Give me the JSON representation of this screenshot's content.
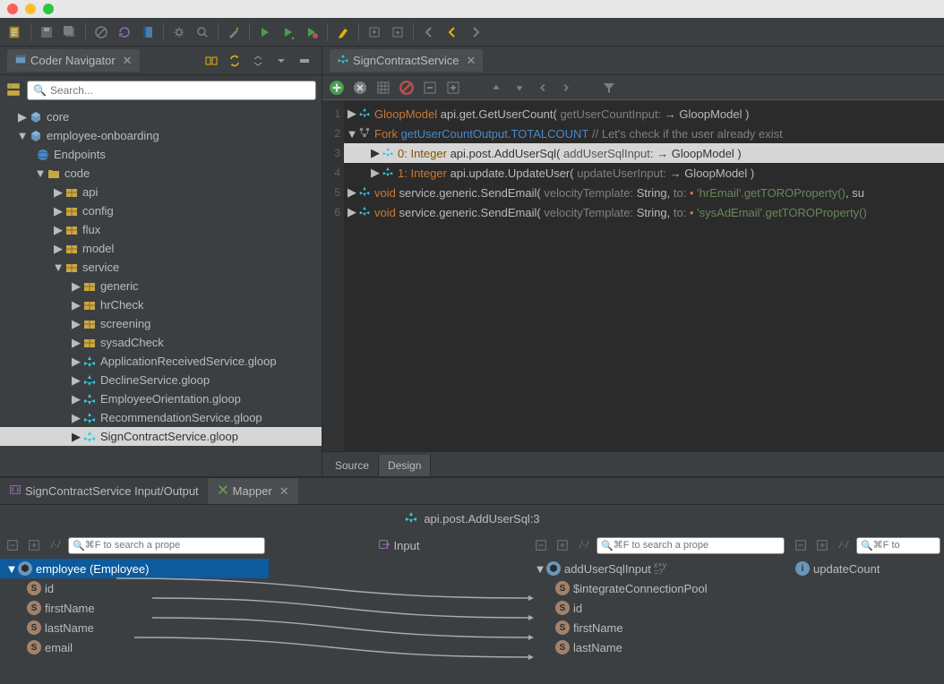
{
  "navigator": {
    "title": "Coder Navigator",
    "search_placeholder": "Search...",
    "tree": {
      "core": "core",
      "proj": "employee-onboarding",
      "endpoints": "Endpoints",
      "code": "code",
      "api": "api",
      "config": "config",
      "flux": "flux",
      "model": "model",
      "service": "service",
      "generic": "generic",
      "hrCheck": "hrCheck",
      "screening": "screening",
      "sysadCheck": "sysadCheck",
      "f1": "ApplicationReceivedService.gloop",
      "f2": "DeclineService.gloop",
      "f3": "EmployeeOrientation.gloop",
      "f4": "RecommendationService.gloop",
      "f5": "SignContractService.gloop"
    }
  },
  "editor": {
    "tab": "SignContractService",
    "lines": {
      "l1a": "GloopModel",
      "l1b": "api.get.GetUserCount(",
      "l1c": "getUserCountInput:",
      "l1d": "→ GloopModel )",
      "l2a": "Fork",
      "l2b": "getUserCountOutput.TOTALCOUNT",
      "l2c": "// Let's check if the user already exist",
      "l3a": "0: Integer",
      "l3b": "api.post.AddUserSql(",
      "l3c": "addUserSqlInput:",
      "l3d": "→ GloopModel )",
      "l4a": "1: Integer",
      "l4b": "api.update.UpdateUser(",
      "l4c": "updateUserInput:",
      "l4d": "→ GloopModel )",
      "l5a": "void",
      "l5b": "service.generic.SendEmail(",
      "l5c": "velocityTemplate:",
      "l5d": "String,",
      "l5e": "to:",
      "l5f": "'hrEmail'.getTOROProperty()",
      "l5g": ", su",
      "l6a": "void",
      "l6b": "service.generic.SendEmail(",
      "l6c": "velocityTemplate:",
      "l6d": "String,",
      "l6e": "to:",
      "l6f": "'sysAdEmail'.getTOROProperty()"
    },
    "footer": {
      "source": "Source",
      "design": "Design"
    }
  },
  "bottom": {
    "tab1": "SignContractService Input/Output",
    "tab2": "Mapper",
    "step_label": "api.post.AddUserSql:3",
    "input_label": "Input",
    "search_placeholder": "⌘F to search a prope",
    "search_placeholder2": "⌘F to",
    "left": {
      "root": "employee (Employee)",
      "id": "id",
      "firstName": "firstName",
      "lastName": "lastName",
      "email": "email"
    },
    "right": {
      "root": "addUserSqlInput",
      "annot": "x+y\n=?",
      "pool": "$integrateConnectionPool",
      "id": "id",
      "firstName": "firstName",
      "lastName": "lastName"
    },
    "far_right": {
      "updateCount": "updateCount"
    }
  }
}
